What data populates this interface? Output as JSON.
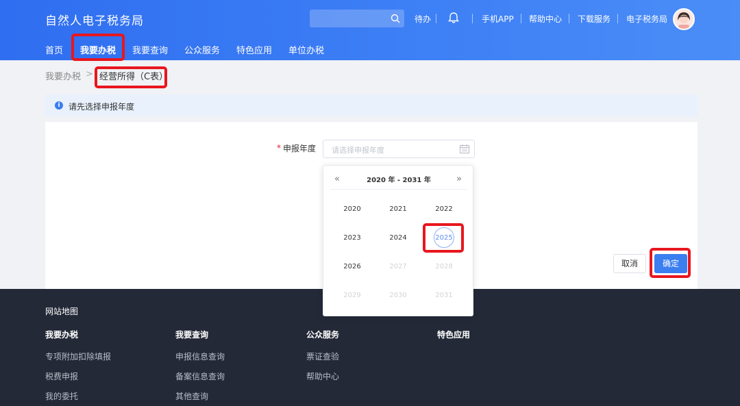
{
  "header": {
    "app_title": "自然人电子税务局",
    "search_placeholder": "",
    "links": [
      "待办",
      "手机APP",
      "帮助中心",
      "下载服务",
      "电子税务局"
    ]
  },
  "nav": {
    "items": [
      "首页",
      "我要办税",
      "我要查询",
      "公众服务",
      "特色应用",
      "单位办税"
    ],
    "active": "我要办税"
  },
  "breadcrumb": {
    "home": "我要办税",
    "separator": ">",
    "current": "经营所得（C表）"
  },
  "notice": {
    "icon": "info-icon",
    "text": "请先选择申报年度"
  },
  "form": {
    "required_mark": "*",
    "year_label": "申报年度",
    "year_placeholder": "请选择申报年度",
    "cancel_label": "取消",
    "confirm_label": "确定"
  },
  "year_picker": {
    "range_label": "2020 年 - 2031 年",
    "prev_label": "«",
    "next_label": "»",
    "years": [
      {
        "label": "2020",
        "state": "normal"
      },
      {
        "label": "2021",
        "state": "normal"
      },
      {
        "label": "2022",
        "state": "normal"
      },
      {
        "label": "2023",
        "state": "normal"
      },
      {
        "label": "2024",
        "state": "normal"
      },
      {
        "label": "2025",
        "state": "selected"
      },
      {
        "label": "2026",
        "state": "normal"
      },
      {
        "label": "2027",
        "state": "disabled"
      },
      {
        "label": "2028",
        "state": "disabled"
      },
      {
        "label": "2029",
        "state": "disabled"
      },
      {
        "label": "2030",
        "state": "disabled"
      },
      {
        "label": "2031",
        "state": "disabled"
      }
    ]
  },
  "footer": {
    "sitemap_title": "网站地图",
    "columns": [
      {
        "title": "我要办税",
        "links": [
          "专项附加扣除填报",
          "税费申报",
          "我的委托"
        ]
      },
      {
        "title": "我要查询",
        "links": [
          "申报信息查询",
          "备案信息查询",
          "其他查询"
        ]
      },
      {
        "title": "公众服务",
        "links": [
          "票证查验",
          "帮助中心"
        ]
      },
      {
        "title": "特色应用",
        "links": []
      }
    ]
  },
  "colors": {
    "brand_blue": "#3a7ef0",
    "highlight_red": "#e8161e",
    "footer_bg": "#232937"
  }
}
